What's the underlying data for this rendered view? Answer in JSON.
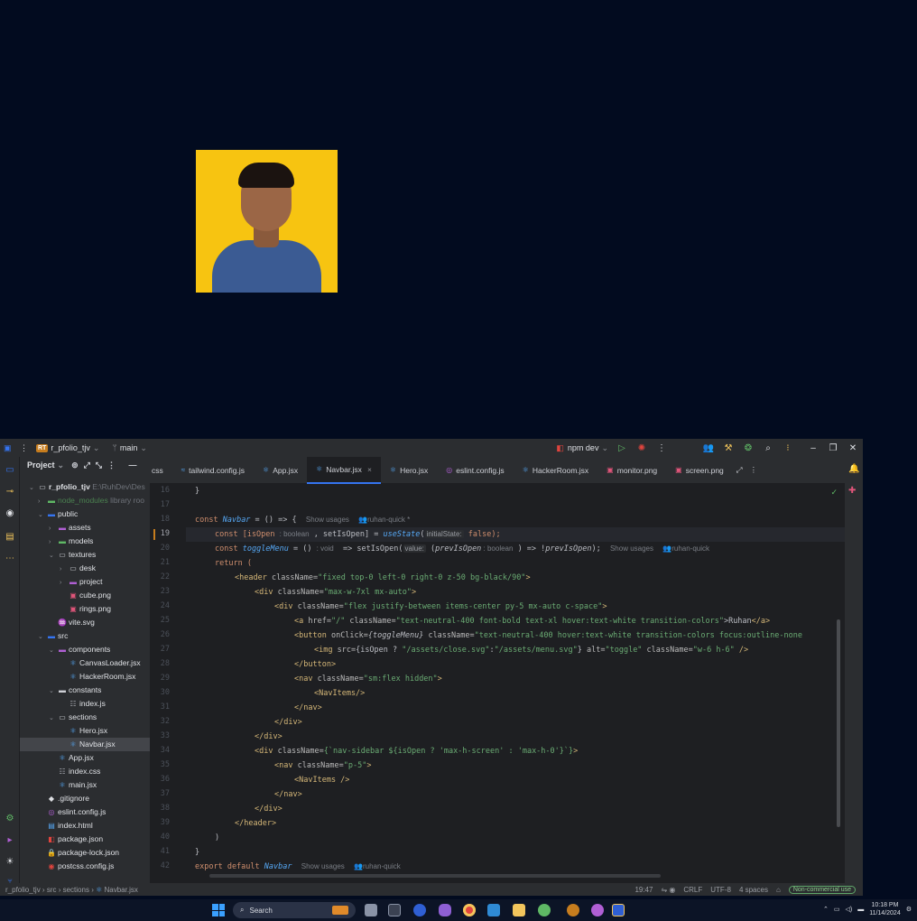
{
  "titlebar": {
    "project_badge": "RT",
    "project_name": "r_pfolio_tjv",
    "branch": "main",
    "run_config": "npm dev"
  },
  "project_panel": {
    "title": "Project",
    "root_name": "r_pfolio_tjv",
    "root_path": "E:\\RuhDev\\Des",
    "node_modules": "node_modules",
    "node_modules_tag": "library roo",
    "items": {
      "public": "public",
      "assets": "assets",
      "models": "models",
      "textures": "textures",
      "desk": "desk",
      "project": "project",
      "cube_png": "cube.png",
      "rings_png": "rings.png",
      "vite_svg": "vite.svg",
      "src": "src",
      "components": "components",
      "canvas_loader": "CanvasLoader.jsx",
      "hacker_room": "HackerRoom.jsx",
      "constants": "constants",
      "index_js": "index.js",
      "sections": "sections",
      "hero": "Hero.jsx",
      "navbar": "Navbar.jsx",
      "app_jsx": "App.jsx",
      "index_css": "index.css",
      "main_jsx": "main.jsx",
      "gitignore": ".gitignore",
      "eslint_config": "eslint.config.js",
      "index_html": "index.html",
      "package_json": "package.json",
      "package_lock": "package-lock.json",
      "postcss": "postcss.config.js"
    }
  },
  "tabs": [
    {
      "label": "css"
    },
    {
      "label": "tailwind.config.js"
    },
    {
      "label": "App.jsx"
    },
    {
      "label": "Navbar.jsx"
    },
    {
      "label": "Hero.jsx"
    },
    {
      "label": "eslint.config.js"
    },
    {
      "label": "HackerRoom.jsx"
    },
    {
      "label": "monitor.png"
    },
    {
      "label": "screen.png"
    }
  ],
  "line_numbers": [
    "16",
    "17",
    "18",
    "19",
    "20",
    "21",
    "22",
    "23",
    "24",
    "25",
    "26",
    "27",
    "28",
    "29",
    "30",
    "31",
    "32",
    "33",
    "34",
    "35",
    "36",
    "37",
    "38",
    "39",
    "40",
    "41",
    "42"
  ],
  "code": {
    "l16": "}",
    "l18_a": "const ",
    "l18_b": "Navbar",
    "l18_c": " = () => {",
    "l18_hint1": "Show usages",
    "l18_hint2": "ruhan-quick *",
    "l19_a": "const [isOpen ",
    "l19_h1": ": boolean",
    "l19_b": " , setIsOpen] = ",
    "l19_c": "useState",
    "l19_d": "(",
    "l19_h2": "initialState:",
    "l19_e": " false);",
    "l20_a": "const ",
    "l20_b": "toggleMenu",
    "l20_c": " = () ",
    "l20_h1": ": void",
    "l20_d": "  => setIsOpen(",
    "l20_h2": "value:",
    "l20_e": " (",
    "l20_f": "prevIsOpen",
    "l20_h3": " : boolean",
    "l20_g": " ) => !",
    "l20_i": "prevIsOpen",
    "l20_j": ");",
    "l20_hint1": "Show usages",
    "l20_hint2": "ruhan-quick",
    "l21": "return (",
    "l22_a": "<header ",
    "l22_b": "className=",
    "l22_c": "\"fixed top-0 left-0 right-0 z-50 bg-black/90\"",
    "l22_d": ">",
    "l23_a": "<div ",
    "l23_b": "className=",
    "l23_c": "\"max-w-7xl mx-auto\"",
    "l23_d": ">",
    "l24_a": "<div ",
    "l24_b": "className=",
    "l24_c": "\"flex justify-between items-center py-5 mx-auto c-space\"",
    "l24_d": ">",
    "l25_a": "<a ",
    "l25_b": "href=",
    "l25_c": "\"/\"",
    "l25_d": " className=",
    "l25_e": "\"text-neutral-400 font-bold text-xl hover:text-white transition-colors\"",
    "l25_f": ">Ruhan",
    "l25_g": "</a>",
    "l26_a": "<button ",
    "l26_b": "onClick=",
    "l26_c": "{toggleMenu}",
    "l26_d": " className=",
    "l26_e": "\"text-neutral-400 hover:text-white transition-colors focus:outline-none",
    "l27_a": "<img ",
    "l27_b": "src=",
    "l27_c": "{isOpen ? ",
    "l27_d": "\"/assets/close.svg\"",
    "l27_e": ":",
    "l27_f": "\"/assets/menu.svg\"",
    "l27_g": "} ",
    "l27_h": "alt=",
    "l27_i": "\"toggle\"",
    "l27_j": " className=",
    "l27_k": "\"w-6 h-6\"",
    "l27_l": " />",
    "l28": "</button>",
    "l29_a": "<nav ",
    "l29_b": "className=",
    "l29_c": "\"sm:flex hidden\"",
    "l29_d": ">",
    "l30": "<NavItems/>",
    "l31": "</nav>",
    "l32": "</div>",
    "l33": "</div>",
    "l34_a": "<div ",
    "l34_b": "className=",
    "l34_c": "{`nav-sidebar ${isOpen ? 'max-h-screen' : 'max-h-0'}`}",
    "l34_d": ">",
    "l35_a": "<nav ",
    "l35_b": "className=",
    "l35_c": "\"p-5\"",
    "l35_d": ">",
    "l36": "<NavItems />",
    "l37": "</nav>",
    "l38": "</div>",
    "l39": "</header>",
    "l40": ")",
    "l41": "}",
    "l42_a": "export default ",
    "l42_b": "Navbar",
    "l42_hint1": "Show usages",
    "l42_hint2": "ruhan-quick"
  },
  "statusbar": {
    "crumb_root": "r_pfolio_tjv",
    "crumb_src": "src",
    "crumb_sections": "sections",
    "crumb_file": "Navbar.jsx",
    "cursor_pos": "19:47",
    "line_sep": "CRLF",
    "encoding": "UTF-8",
    "indent": "4 spaces",
    "license": "Non-commercial use"
  },
  "taskbar": {
    "search_label": "Search",
    "time": "10:18 PM",
    "date": "11/14/2024"
  },
  "colors": {
    "desktop_bg": "#020b1f",
    "photo_bg": "#f7c411",
    "accent": "#3574f0"
  }
}
